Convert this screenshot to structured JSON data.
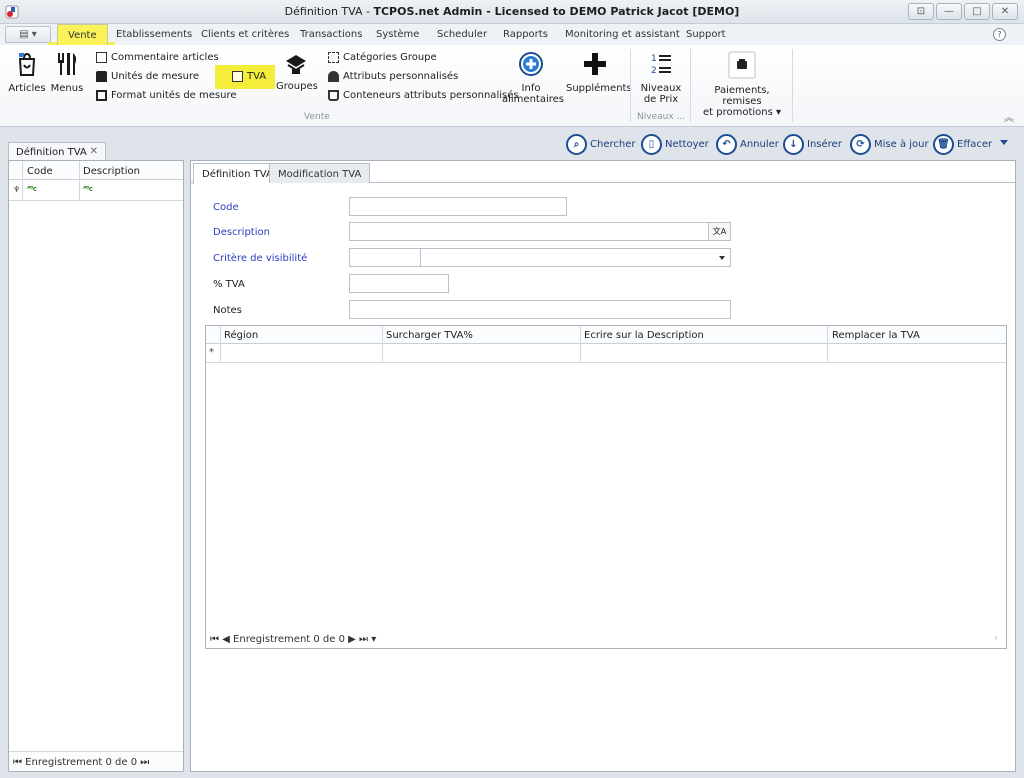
{
  "window": {
    "title_prefix": "Définition TVA - ",
    "title_bold": "TCPOS.net Admin - Licensed to DEMO Patrick Jacot [DEMO]",
    "buttons": [
      "⊡",
      "—",
      "□",
      "✕"
    ]
  },
  "menu": {
    "tabs": [
      "Vente",
      "Etablissements",
      "Clients et critères",
      "Transactions",
      "Système",
      "Scheduler",
      "Rapports",
      "Monitoring et assistant",
      "Support"
    ],
    "active": "Vente",
    "help": "?"
  },
  "ribbon": {
    "articles": "Articles",
    "menus": "Menus",
    "commentaire": "Commentaire articles",
    "unites": "Unités de mesure",
    "format": "Format unités de mesure",
    "tva": "TVA",
    "groupes": "Groupes",
    "categories": "Catégories Groupe",
    "attributs": "Attributs personnalisés",
    "conteneurs": "Conteneurs attributs personnalisés",
    "info_line1": "Info",
    "info_line2": "alimentaires",
    "supplements": "Suppléments",
    "niveaux_line1": "Niveaux",
    "niveaux_line2": "de Prix",
    "paiements_line1": "Paiements, remises",
    "paiements_line2": "et promotions ▾",
    "group_vente": "Vente",
    "group_niveaux": "Niveaux ..."
  },
  "document_tab": {
    "label": "Définition TVA",
    "close": "✕"
  },
  "toolbar": {
    "chercher": "Chercher",
    "nettoyer": "Nettoyer",
    "annuler": "Annuler",
    "inserer": "Insérer",
    "mise_a_jour": "Mise à jour",
    "effacer": "Effacer"
  },
  "left_grid": {
    "columns": [
      "Code",
      "Description"
    ],
    "filter_glyph": "ᴬᴮc",
    "nav": "⏮ Enregistrement 0 de 0 ⏭"
  },
  "form": {
    "tabs": [
      "Définition TVA",
      "Modification TVA"
    ],
    "labels": {
      "code": "Code",
      "description": "Description",
      "critere": "Critère de visibilité",
      "pct_tva": "% TVA",
      "notes": "Notes"
    },
    "translate": "文A",
    "values": {
      "code": "",
      "description": "",
      "critere_code": "",
      "critere": "",
      "pct_tva": "",
      "notes": ""
    }
  },
  "detail_grid": {
    "columns": [
      "Région",
      "Surcharger TVA%",
      "Ecrire sur la Description",
      "Remplacer la TVA"
    ],
    "new_row": "*",
    "nav": "⏮ ◀ Enregistrement 0 de 0 ▶ ⏭ ▾"
  }
}
